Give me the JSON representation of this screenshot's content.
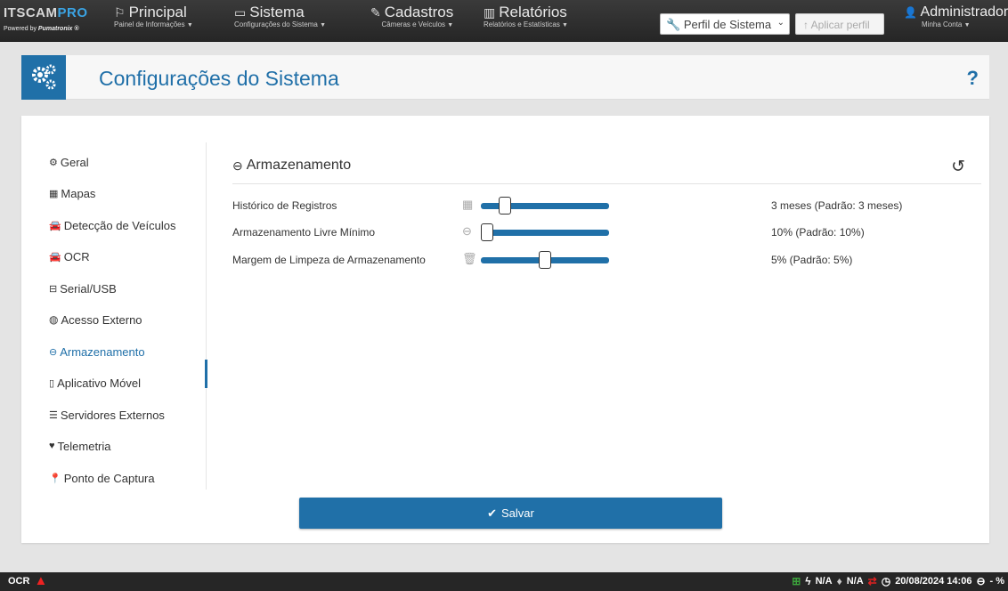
{
  "brand": {
    "logo_text": "ITSCAM",
    "logo_suffix": "PRO",
    "powered_prefix": "Powered by ",
    "powered_company": "Pumatronix ®"
  },
  "nav": [
    {
      "icon": "flag-icon",
      "title": "Principal",
      "subtitle": "Painel de Informações"
    },
    {
      "icon": "monitor-icon",
      "title": "Sistema",
      "subtitle": "Configurações do Sistema"
    },
    {
      "icon": "edit-icon",
      "title": "Cadastros",
      "subtitle": "Câmeras e Veículos"
    },
    {
      "icon": "bar-chart-icon",
      "title": "Relatórios",
      "subtitle": "Relatórios e Estatísticas"
    }
  ],
  "profile": {
    "selected": "Perfil de Sistema",
    "apply_label": "Aplicar perfil"
  },
  "user": {
    "name": "Administrador",
    "subtitle": "Minha Conta"
  },
  "page": {
    "title": "Configurações do Sistema",
    "help": "?"
  },
  "sidebar": {
    "items": [
      {
        "label": "Geral",
        "icon": "gears-icon"
      },
      {
        "label": "Mapas",
        "icon": "map-icon"
      },
      {
        "label": "Detecção de Veículos",
        "icon": "car-icon"
      },
      {
        "label": "OCR",
        "icon": "car-icon"
      },
      {
        "label": "Serial/USB",
        "icon": "serial-port-icon"
      },
      {
        "label": "Acesso Externo",
        "icon": "globe-icon"
      },
      {
        "label": "Armazenamento",
        "icon": "hard-drive-icon",
        "active": true
      },
      {
        "label": "Aplicativo Móvel",
        "icon": "mobile-icon"
      },
      {
        "label": "Servidores Externos",
        "icon": "server-icon"
      },
      {
        "label": "Telemetria",
        "icon": "heartbeat-icon"
      },
      {
        "label": "Ponto de Captura",
        "icon": "pushpin-icon"
      }
    ]
  },
  "section": {
    "title": "Armazenamento"
  },
  "settings": [
    {
      "label": "Histórico de Registros",
      "icon": "calendar-icon",
      "value_text": "3 meses  (Padrão: 3 meses)",
      "level": 0.15
    },
    {
      "label": "Armazenamento Livre Mínimo",
      "icon": "hard-drive-icon",
      "value_text": "10%  (Padrão: 10%)",
      "level": 0.0
    },
    {
      "label": "Margem de Limpeza de Armazenamento",
      "icon": "trash-icon",
      "value_text": "5%  (Padrão: 5%)",
      "level": 0.5
    }
  ],
  "save_label": "Salvar",
  "footer": {
    "left_label": "OCR",
    "left_status": "warning",
    "status1": "N/A",
    "status2": "N/A",
    "datetime": "20/08/2024 14:06",
    "storage": "- %"
  },
  "colors": {
    "accent": "#2070a8",
    "navbar": "#2e2e2e",
    "warning": "#e22222",
    "network_ok": "#3ca33c",
    "connection_error": "#e22222"
  }
}
